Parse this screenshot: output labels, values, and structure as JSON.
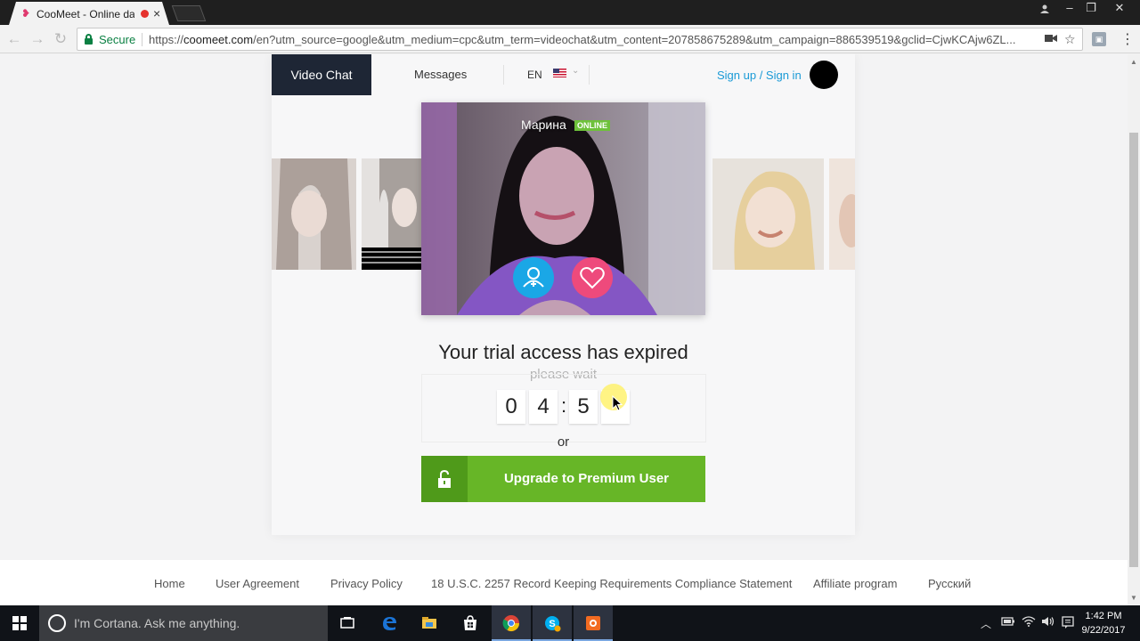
{
  "browser": {
    "tab_title": "CooMeet - Online dat",
    "tab_close": "×",
    "security_label": "Secure",
    "url_scheme": "https://",
    "url_host": "coomeet.com",
    "url_path": "/en?utm_source=google&utm_medium=cpc&utm_term=videochat&utm_content=207858675289&utm_campaign=886539519&gclid=CjwKCAjw6ZL...",
    "icons": [
      "back-icon",
      "forward-icon",
      "reload-icon",
      "lock-icon",
      "camera-icon",
      "star-icon",
      "extension-icon",
      "menu-icon"
    ],
    "window_buttons": [
      "minimize",
      "maximize",
      "close"
    ]
  },
  "site": {
    "nav": {
      "video_chat": "Video Chat",
      "messages": "Messages",
      "language": "EN",
      "sign_in": "Sign up / Sign in"
    },
    "video": {
      "name": "Марина",
      "status": "ONLINE"
    },
    "trial": {
      "headline": "Your trial access has expired",
      "subtext": "please wait",
      "timer": [
        "0",
        "4",
        "5",
        ""
      ],
      "timer_separator": ":",
      "or": "or",
      "upgrade_label": "Upgrade to Premium User"
    },
    "footer": {
      "links": [
        "Home",
        "User Agreement",
        "Privacy Policy",
        "18 U.S.C. 2257 Record Keeping Requirements Compliance Statement",
        "Affiliate program",
        "Русский"
      ]
    },
    "colors": {
      "nav_active": "#1e2635",
      "link_blue": "#1a9ad6",
      "upgrade_green": "#67b627",
      "online_green": "#6ec13a",
      "like_pink": "#ee4a7c",
      "profile_blue": "#1aa7e6"
    }
  },
  "taskbar": {
    "search_placeholder": "I'm Cortana. Ask me anything.",
    "apps": [
      "task-view-icon",
      "edge-icon",
      "file-explorer-icon",
      "store-icon",
      "chrome-icon",
      "skype-icon",
      "recorder-icon"
    ],
    "tray_icons": [
      "chevron-up-icon",
      "battery-icon",
      "wifi-icon",
      "volume-icon",
      "notifications-icon"
    ],
    "time": "1:42 PM",
    "date": "9/22/2017"
  }
}
